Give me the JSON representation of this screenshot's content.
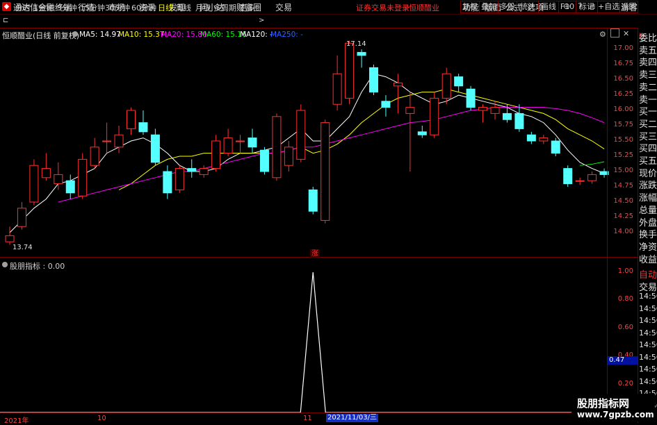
{
  "app": {
    "name": "通达信金融终端"
  },
  "menu": {
    "items": [
      "行情",
      "市场",
      "资讯",
      "发现",
      "问小达",
      "财富圈",
      "交易"
    ],
    "warn": "证券交易未登录",
    "stock": "恒顺醋业",
    "right": [
      "功能",
      "版面",
      "公式",
      "选项"
    ],
    "guest": "游客"
  },
  "periods": [
    "分时",
    "1分钟",
    "5分钟",
    "15分钟",
    "30分钟",
    "60分钟",
    "日线",
    "周线",
    "月线",
    "多周期",
    "更多"
  ],
  "active_period": "日线",
  "toolbar": {
    "buttons": [
      "复权",
      "叠加",
      "多股",
      "统计",
      "画线",
      "F10",
      "标记",
      "+自选",
      "返回"
    ]
  },
  "stock_title": "恒顺醋业(日线 前复权)",
  "ma_legend": [
    {
      "label": "MA5: 14.97",
      "color": "#ffffff"
    },
    {
      "label": "MA10: 15.37",
      "color": "#ffff00"
    },
    {
      "label": "MA20: 15.80",
      "color": "#ff00ff"
    },
    {
      "label": "MA60: 15.16",
      "color": "#00ff00"
    },
    {
      "label": "MA120: -",
      "color": "#ffffff"
    },
    {
      "label": "MA250: -",
      "color": "#3060ff"
    }
  ],
  "right_panel": {
    "top_label": "比",
    "items": [
      "委比",
      "卖五",
      "卖四",
      "卖三",
      "卖二",
      "卖一",
      "买一",
      "买二",
      "买三",
      "买四",
      "买五",
      "现价",
      "涨跌",
      "涨幅",
      "总量",
      "外盘",
      "换手",
      "净资",
      "收益"
    ],
    "bottom": [
      "自动",
      "交易",
      "14:56",
      "14:56",
      "14:56",
      "14:56",
      "14:56",
      "14:56",
      "14:56",
      "14:56",
      "14:56",
      "14:56"
    ]
  },
  "indicator": {
    "title": "股朋指标 : 0.00",
    "highlight": "0.47",
    "yticks": [
      "1.00",
      "0.80",
      "0.60",
      "0.40",
      "0.20"
    ]
  },
  "price_axis": [
    "17.00",
    "16.75",
    "16.50",
    "16.25",
    "16.00",
    "15.75",
    "15.50",
    "15.25",
    "15.00",
    "14.75",
    "14.50",
    "14.25",
    "14.00"
  ],
  "annotations": {
    "high": "17.14",
    "low": "13.74",
    "zhang": "涨"
  },
  "x_axis": {
    "labels": [
      "2021年",
      "10",
      "11"
    ],
    "cursor_date": "2021/11/03/三"
  },
  "watermark": {
    "line1": "股朋指标网",
    "line2": "www.7gpzb.com"
  },
  "chart_data": {
    "type": "candlestick",
    "ylim": [
      13.7,
      17.3
    ],
    "candles": [
      {
        "o": 13.85,
        "c": 13.95,
        "h": 14.1,
        "l": 13.8
      },
      {
        "o": 14.1,
        "c": 14.4,
        "h": 14.5,
        "l": 14.05
      },
      {
        "o": 14.5,
        "c": 15.1,
        "h": 15.2,
        "l": 14.45
      },
      {
        "o": 14.9,
        "c": 15.05,
        "h": 15.3,
        "l": 14.85
      },
      {
        "o": 14.8,
        "c": 14.95,
        "h": 15.15,
        "l": 14.7
      },
      {
        "o": 14.85,
        "c": 14.65,
        "h": 14.95,
        "l": 14.55
      },
      {
        "o": 14.6,
        "c": 15.2,
        "h": 15.3,
        "l": 14.55
      },
      {
        "o": 15.1,
        "c": 15.4,
        "h": 15.55,
        "l": 15.05
      },
      {
        "o": 15.5,
        "c": 15.5,
        "h": 15.8,
        "l": 15.3
      },
      {
        "o": 15.4,
        "c": 15.6,
        "h": 15.75,
        "l": 15.3
      },
      {
        "o": 15.7,
        "c": 16.0,
        "h": 16.05,
        "l": 15.6
      },
      {
        "o": 15.8,
        "c": 15.65,
        "h": 16.0,
        "l": 15.6
      },
      {
        "o": 15.6,
        "c": 15.15,
        "h": 15.7,
        "l": 15.1
      },
      {
        "o": 15.0,
        "c": 14.65,
        "h": 15.1,
        "l": 14.55
      },
      {
        "o": 14.7,
        "c": 15.05,
        "h": 15.1,
        "l": 14.65
      },
      {
        "o": 15.05,
        "c": 15.0,
        "h": 15.2,
        "l": 14.9
      },
      {
        "o": 14.95,
        "c": 15.05,
        "h": 15.1,
        "l": 14.9
      },
      {
        "o": 15.05,
        "c": 15.5,
        "h": 15.6,
        "l": 15.0
      },
      {
        "o": 15.3,
        "c": 15.55,
        "h": 15.7,
        "l": 15.25
      },
      {
        "o": 15.5,
        "c": 15.5,
        "h": 15.6,
        "l": 15.3
      },
      {
        "o": 15.55,
        "c": 15.4,
        "h": 15.7,
        "l": 15.3
      },
      {
        "o": 15.35,
        "c": 15.0,
        "h": 15.4,
        "l": 14.95
      },
      {
        "o": 14.9,
        "c": 15.9,
        "h": 15.95,
        "l": 14.85
      },
      {
        "o": 15.1,
        "c": 15.4,
        "h": 15.5,
        "l": 15.0
      },
      {
        "o": 15.2,
        "c": 16.0,
        "h": 16.1,
        "l": 15.15
      },
      {
        "o": 14.7,
        "c": 14.35,
        "h": 14.75,
        "l": 14.3
      },
      {
        "o": 14.2,
        "c": 15.8,
        "h": 15.85,
        "l": 14.15
      },
      {
        "o": 16.1,
        "c": 16.6,
        "h": 16.9,
        "l": 16.0
      },
      {
        "o": 16.2,
        "c": 17.1,
        "h": 17.14,
        "l": 16.1
      },
      {
        "o": 16.95,
        "c": 16.9,
        "h": 17.0,
        "l": 16.7
      },
      {
        "o": 16.7,
        "c": 16.3,
        "h": 16.75,
        "l": 16.25
      },
      {
        "o": 16.15,
        "c": 16.05,
        "h": 16.25,
        "l": 15.9
      },
      {
        "o": 16.4,
        "c": 16.45,
        "h": 16.6,
        "l": 15.95
      },
      {
        "o": 15.95,
        "c": 16.05,
        "h": 16.3,
        "l": 15.0
      },
      {
        "o": 15.65,
        "c": 15.6,
        "h": 15.75,
        "l": 15.55
      },
      {
        "o": 15.6,
        "c": 16.2,
        "h": 16.3,
        "l": 15.55
      },
      {
        "o": 16.2,
        "c": 16.6,
        "h": 16.7,
        "l": 16.1
      },
      {
        "o": 16.55,
        "c": 16.4,
        "h": 16.6,
        "l": 16.3
      },
      {
        "o": 16.35,
        "c": 16.05,
        "h": 16.4,
        "l": 16.0
      },
      {
        "o": 16.0,
        "c": 16.05,
        "h": 16.1,
        "l": 15.8
      },
      {
        "o": 15.95,
        "c": 16.05,
        "h": 16.15,
        "l": 15.85
      },
      {
        "o": 15.95,
        "c": 15.85,
        "h": 16.1,
        "l": 15.8
      },
      {
        "o": 15.95,
        "c": 15.7,
        "h": 16.1,
        "l": 15.65
      },
      {
        "o": 15.6,
        "c": 15.5,
        "h": 15.65,
        "l": 15.45
      },
      {
        "o": 15.5,
        "c": 15.55,
        "h": 15.6,
        "l": 15.45
      },
      {
        "o": 15.5,
        "c": 15.3,
        "h": 15.55,
        "l": 15.25
      },
      {
        "o": 15.05,
        "c": 14.8,
        "h": 15.1,
        "l": 14.75
      },
      {
        "o": 14.85,
        "c": 14.85,
        "h": 14.9,
        "l": 14.78
      },
      {
        "o": 14.85,
        "c": 14.95,
        "h": 15.0,
        "l": 14.8
      },
      {
        "o": 15.0,
        "c": 14.95,
        "h": 15.05,
        "l": 14.9
      }
    ],
    "ma5": [
      14.0,
      14.2,
      14.4,
      14.55,
      14.8,
      14.85,
      14.95,
      15.05,
      15.3,
      15.4,
      15.5,
      15.55,
      15.45,
      15.3,
      15.1,
      15.0,
      15.0,
      15.05,
      15.2,
      15.3,
      15.3,
      15.35,
      15.4,
      15.55,
      15.7,
      15.5,
      15.5,
      15.7,
      15.9,
      16.3,
      16.6,
      16.55,
      16.45,
      16.3,
      16.2,
      16.1,
      16.15,
      16.25,
      16.2,
      16.15,
      16.1,
      16.05,
      15.95,
      15.9,
      15.8,
      15.6,
      15.35,
      15.15,
      15.05,
      14.97
    ],
    "ma10": [
      null,
      null,
      null,
      null,
      null,
      null,
      null,
      null,
      null,
      14.7,
      14.8,
      14.95,
      15.1,
      15.2,
      15.25,
      15.25,
      15.3,
      15.3,
      15.3,
      15.3,
      15.3,
      15.3,
      15.3,
      15.35,
      15.4,
      15.3,
      15.35,
      15.45,
      15.6,
      15.8,
      15.95,
      16.1,
      16.2,
      16.25,
      16.3,
      16.3,
      16.35,
      16.3,
      16.25,
      16.2,
      16.15,
      16.1,
      16.05,
      16.0,
      15.95,
      15.85,
      15.7,
      15.6,
      15.5,
      15.37
    ],
    "ma20": [
      null,
      null,
      null,
      null,
      14.5,
      14.55,
      14.6,
      14.65,
      14.7,
      14.75,
      14.8,
      14.85,
      14.9,
      14.95,
      15.0,
      15.0,
      15.05,
      15.1,
      15.15,
      15.2,
      15.25,
      15.3,
      15.3,
      15.35,
      15.4,
      15.4,
      15.45,
      15.5,
      15.55,
      15.6,
      15.65,
      15.7,
      15.75,
      15.8,
      15.82,
      15.85,
      15.9,
      15.95,
      16.0,
      16.02,
      16.05,
      16.05,
      16.05,
      16.05,
      16.05,
      16.03,
      16.0,
      15.95,
      15.88,
      15.8
    ],
    "ma60_tail": [
      15.1,
      15.12,
      15.16
    ],
    "indicator_values": {
      "zero_to_spike": 0.0,
      "spike_at_index": 25,
      "spike_value": 1.0
    }
  }
}
